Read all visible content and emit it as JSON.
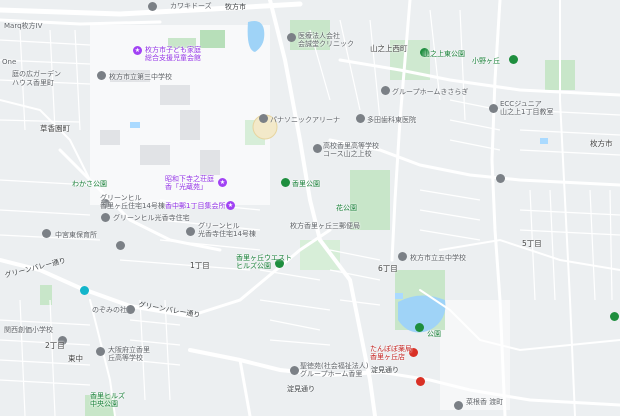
{
  "map": {
    "labels": {
      "l_hirakata_top": "カワキドーズ",
      "l_hirakata_ave": "牧方市",
      "l_marq": "Marq枚方IV",
      "l_one": "One",
      "l_garden": "庭の広ガーデン",
      "l_house": "ハウス香里町",
      "l_kosodate": "枚方市子ども家庭\n総合支援児童会館",
      "l_school1": "枚方市立第三中学校",
      "l_hospital": "医療法人会社\n会誠堂クリニック",
      "l_yamanoue_w": "山之上西町",
      "l_yamanoue_e": "山之上東公園",
      "l_shonan": "小野ヶ丘",
      "l_osakaroad": "山之上通",
      "l_kazoku": "グループホームきさらぎ",
      "l_ecc": "ECCジュニア\n山之上1丁目教室",
      "l_hirakata_r": "枚方市",
      "l_panasonic": "パナソニックアリーナ",
      "l_tamagawa": "多田歯科東医院",
      "l_kokusai": "高校香里高等学校\nコース山之上校",
      "l_koriyama": "草香園町",
      "l_kaishun": "昭和下寺之荘庭\n香「光蔵苑」",
      "l_dojo": "香中郵便局",
      "l_shokai": "香中郵1丁目集会所",
      "l_nori": "香里公園",
      "l_higashi1": "わかさ公園",
      "l_green1": "グリーンヒル\n香里ヶ丘住宅14号棟",
      "l_green2": "グリーンヒル光香寺住宅",
      "l_green3": "グリーンヒル\n光香寺住宅14号棟",
      "l_koen2": "花公園",
      "l_yamanoue3": "山之上1丁目集会所",
      "l_hakusan": "枚方香里ヶ丘三郵便局",
      "l_nakamiya": "中宮東保育所",
      "l_valley": "グリーンバレー通り",
      "l_kozan": "香里ヶ丘ウエスト\nヒルズ公園",
      "l_chome1": "1丁目",
      "l_chome5": "5丁目",
      "l_chome6": "6丁目",
      "l_school5": "枚方市立五中学校",
      "l_nozomi": "のぞみの社",
      "l_kansai": "関西創価小学校",
      "l_2chome": "2丁目",
      "l_higashi": "東中",
      "l_osaka_hs": "大阪府立香里\n丘高等学校",
      "l_valley2": "グリーンバレー通り",
      "l_yoshitake": "聖徳苑(社会福祉法人)\nグループホーム香里",
      "l_dojo2": "淀見通り",
      "l_kabuki": "たんぽぽ薬局\n香里ヶ丘店",
      "l_kaigi": "公園",
      "l_kori_hills": "香里ヒルズ\n中央公園",
      "l_road_bottom": "淀見通り",
      "l_bottom_r": "菜根香 渡町"
    },
    "colors": {
      "road": "#ffffff",
      "park": "#c8e6c9",
      "water": "#aadaff",
      "block": "#e8eaed"
    }
  }
}
